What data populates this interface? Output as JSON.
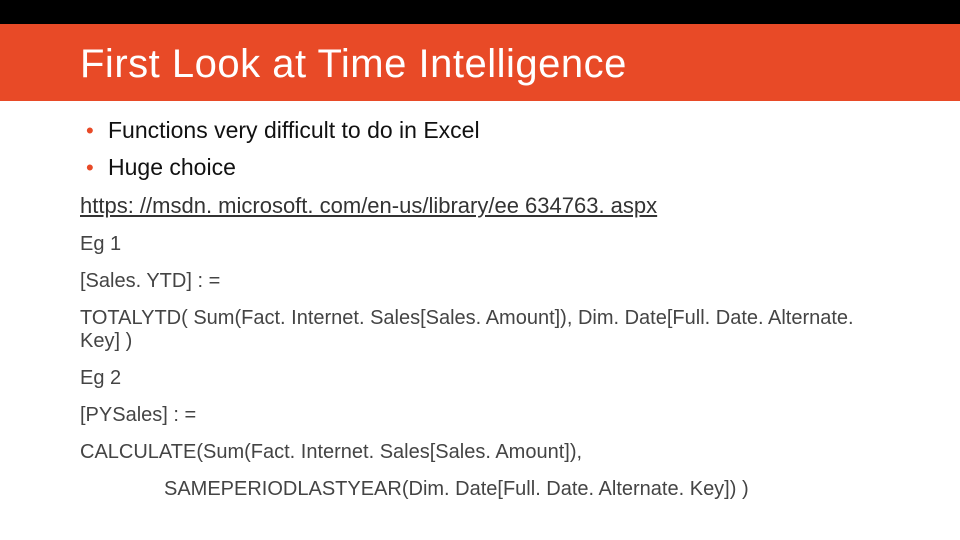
{
  "title": "First Look at Time Intelligence",
  "bullets": [
    "Functions very difficult to do in Excel",
    "Huge choice"
  ],
  "link": "https: //msdn. microsoft. com/en-us/library/ee 634763. aspx",
  "eg1_label": "Eg 1",
  "eg1_measure": "[Sales. YTD] : =",
  "eg1_formula": "TOTALYTD( Sum(Fact. Internet. Sales[Sales. Amount]), Dim. Date[Full. Date. Alternate. Key] )",
  "eg2_label": "Eg 2",
  "eg2_measure": "[PYSales] : =",
  "eg2_formula_line1": "CALCULATE(Sum(Fact. Internet. Sales[Sales. Amount]),",
  "eg2_formula_line2": "SAMEPERIODLASTYEAR(Dim. Date[Full. Date. Alternate. Key])   )",
  "colors": {
    "accent": "#e84a27"
  }
}
